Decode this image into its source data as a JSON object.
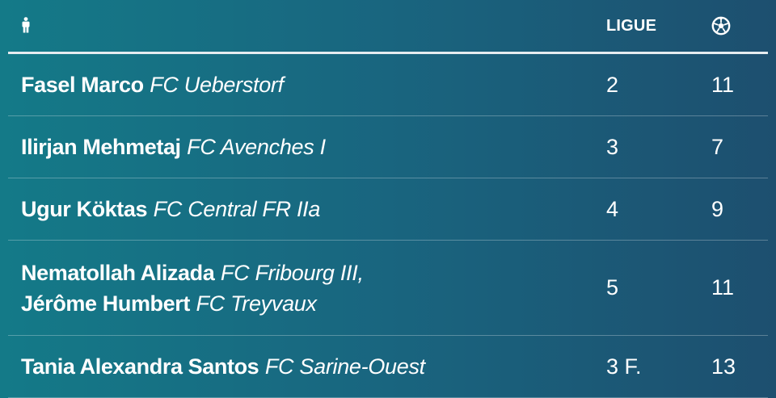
{
  "header": {
    "player_icon": "person-icon",
    "league_label": "LIGUE",
    "goals_icon": "soccer-ball-icon"
  },
  "rows": [
    {
      "players": [
        {
          "name": "Fasel Marco",
          "club": "FC Ueberstorf",
          "sep": ""
        }
      ],
      "league": "2",
      "goals": "11"
    },
    {
      "players": [
        {
          "name": "Ilirjan Mehmetaj",
          "club": "FC Avenches I",
          "sep": ""
        }
      ],
      "league": "3",
      "goals": "7"
    },
    {
      "players": [
        {
          "name": "Ugur Köktas",
          "club": "FC Central FR IIa",
          "sep": ""
        }
      ],
      "league": "4",
      "goals": "9"
    },
    {
      "players": [
        {
          "name": "Nematollah Alizada",
          "club": "FC Fribourg III",
          "sep": ","
        },
        {
          "name": "Jérôme Humbert",
          "club": "FC Treyvaux",
          "sep": ""
        }
      ],
      "league": "5",
      "goals": "11"
    },
    {
      "players": [
        {
          "name": "Tania Alexandra Santos",
          "club": "FC Sarine-Ouest",
          "sep": ""
        }
      ],
      "league": "3 F.",
      "goals": "13"
    }
  ]
}
